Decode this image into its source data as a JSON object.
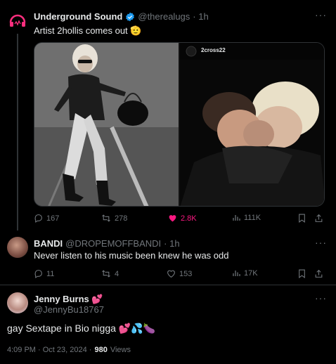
{
  "tweet1": {
    "name": "Underground Sound",
    "handle": "@therealugs",
    "time": "· 1h",
    "text": "Artist 2hollis comes out 🫡",
    "video_credit": "2cross22",
    "stats": {
      "replies": "167",
      "retweets": "278",
      "likes": "2.8K",
      "views": "111K"
    }
  },
  "tweet2": {
    "name": "BANDI",
    "handle": "@DROPEMOFFBANDI",
    "time": "· 1h",
    "text": "Never listen to his music been knew he was odd",
    "stats": {
      "replies": "11",
      "retweets": "4",
      "likes": "153",
      "views": "17K"
    }
  },
  "tweet3": {
    "name": "Jenny Burns 💕",
    "handle": "@JennyBu18767",
    "text": "gay Sextape in Bio nigga 💕💦🍆",
    "timestamp": "4:09 PM · Oct 23, 2024 ·",
    "views_count": "980",
    "views_label": "Views"
  },
  "colors": {
    "accent": "#1d9bf0",
    "like": "#f91880",
    "muted": "#71767b",
    "text": "#e7e9ea",
    "bg": "#000000"
  }
}
